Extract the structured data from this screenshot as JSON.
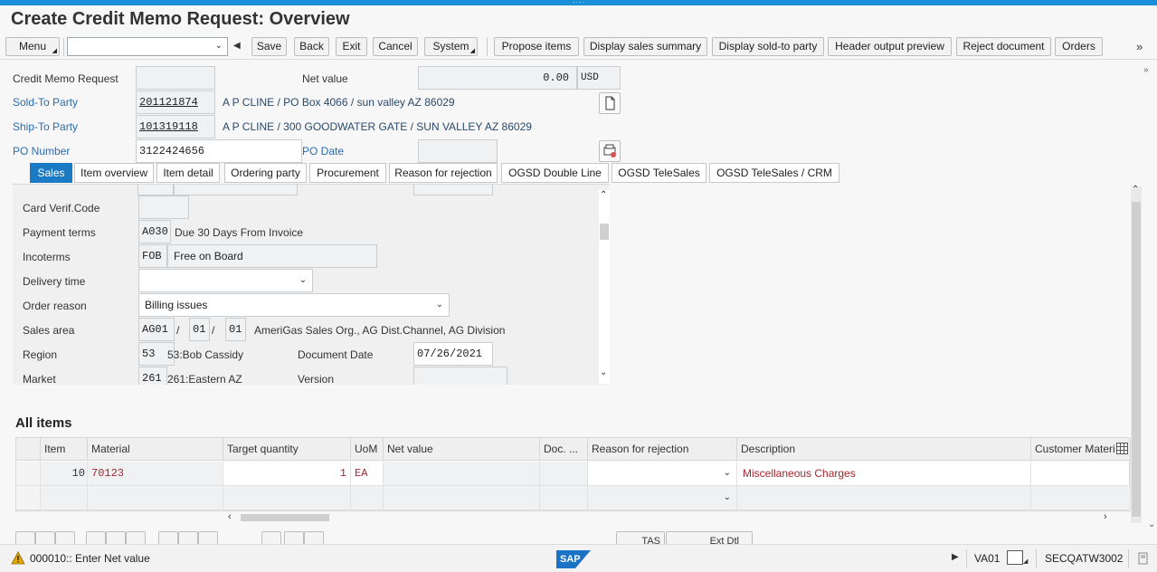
{
  "window": {
    "title": "Create Credit Memo Request: Overview"
  },
  "toolbar": {
    "menu_label": "Menu",
    "command_field_value": "",
    "save_label": "Save",
    "back_label": "Back",
    "exit_label": "Exit",
    "cancel_label": "Cancel",
    "system_label": "System",
    "propose_items_label": "Propose items",
    "display_sales_summary_label": "Display sales summary",
    "display_sold_to_label": "Display sold-to party",
    "header_output_label": "Header output preview",
    "reject_document_label": "Reject document",
    "orders_label": "Orders",
    "more_icon": "double-chevron-right"
  },
  "header": {
    "credit_memo_label": "Credit Memo Request",
    "credit_memo_value": "",
    "net_value_label": "Net value",
    "net_value": "0.00",
    "currency": "USD",
    "sold_to_label": "Sold-To Party",
    "sold_to_value": "201121874",
    "sold_to_desc": "A P CLINE / PO Box 4066 / sun valley AZ 86029",
    "ship_to_label": "Ship-To Party",
    "ship_to_value": "101319118",
    "ship_to_desc": "A P CLINE / 300 GOODWATER GATE / SUN VALLEY AZ 86029",
    "po_number_label": "PO Number",
    "po_number_value": "3122424656",
    "po_date_label": "PO Date",
    "po_date_value": ""
  },
  "tabs": [
    {
      "label": "Sales",
      "active": true
    },
    {
      "label": "Item overview"
    },
    {
      "label": "Item detail"
    },
    {
      "label": "Ordering party"
    },
    {
      "label": "Procurement"
    },
    {
      "label": "Reason for rejection"
    },
    {
      "label": "OGSD Double Line"
    },
    {
      "label": "OGSD TeleSales"
    },
    {
      "label": "OGSD TeleSales / CRM"
    }
  ],
  "sales": {
    "card_verif_label": "Card Verif.Code",
    "card_verif_value": "",
    "payment_terms_label": "Payment terms",
    "payment_terms_code": "A030",
    "payment_terms_desc": "Due 30 Days From Invoice",
    "incoterms_label": "Incoterms",
    "incoterms_code": "FOB",
    "incoterms_desc": "Free on Board",
    "delivery_time_label": "Delivery time",
    "delivery_time_value": "",
    "order_reason_label": "Order reason",
    "order_reason_value": "Billing issues",
    "sales_area_label": "Sales area",
    "sales_org": "AG01",
    "dist_channel": "01",
    "division": "01",
    "sep": "/",
    "sales_area_desc": "AmeriGas Sales Org., AG Dist.Channel, AG Division",
    "region_label": "Region",
    "region_code": "53",
    "region_desc": "53:Bob Cassidy",
    "document_date_label": "Document Date",
    "document_date_value": "07/26/2021",
    "market_label": "Market",
    "market_code": "261",
    "market_desc": "261:Eastern AZ",
    "version_label": "Version",
    "version_value": ""
  },
  "items": {
    "title": "All items",
    "columns": [
      "Item",
      "Material",
      "Target quantity",
      "UoM",
      "Net value",
      "Doc. ...",
      "Reason for rejection",
      "Description",
      "Customer Materi"
    ],
    "rows": [
      {
        "item": "10",
        "material": "70123",
        "target_qty": "1",
        "uom": "EA",
        "net_value": "",
        "doc": "",
        "reason": "",
        "description": "Miscellaneous Charges",
        "customer_material": ""
      },
      {
        "item": "",
        "material": "",
        "target_qty": "",
        "uom": "",
        "net_value": "",
        "doc": "",
        "reason": "",
        "description": "",
        "customer_material": ""
      }
    ],
    "column_settings_icon": "table-settings"
  },
  "bottom_toolbar": {
    "tas_label": "TAS",
    "ext_dtl_label": "Ext Dtl"
  },
  "status": {
    "message": "000010:: Enter Net value",
    "transaction": "VA01",
    "server": "SECQATW3002",
    "logo_text": "SAP"
  },
  "colors": {
    "accent": "#1a8fd8",
    "tab_active": "#1a7bc4",
    "link": "#2a6cb0",
    "error_text": "#a4262c",
    "warning": "#e6a700"
  }
}
